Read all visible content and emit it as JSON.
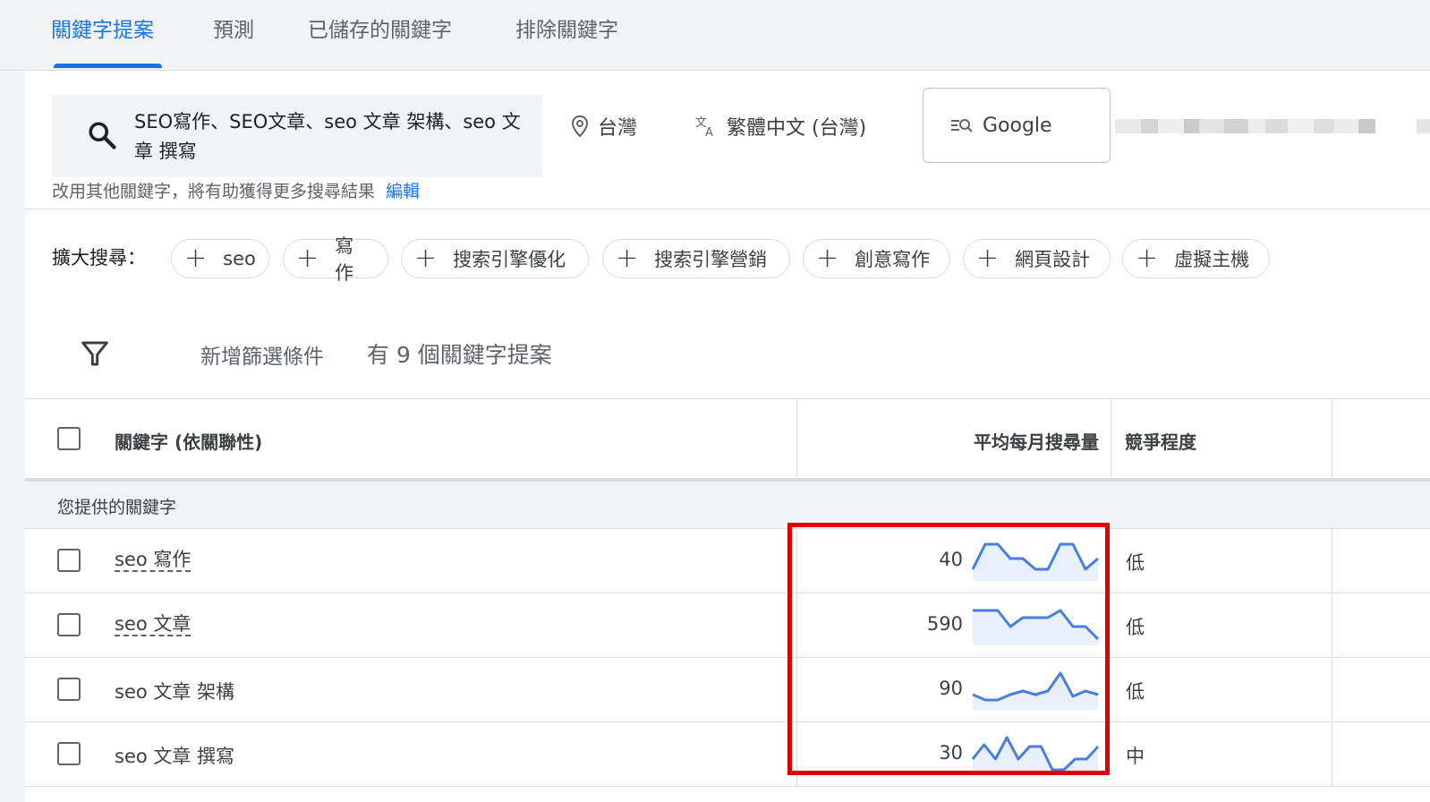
{
  "tabs": [
    {
      "label": "關鍵字提案",
      "active": true
    },
    {
      "label": "預測",
      "active": false
    },
    {
      "label": "已儲存的關鍵字",
      "active": false
    },
    {
      "label": "排除關鍵字",
      "active": false
    }
  ],
  "search": {
    "query": "SEO寫作、SEO文章、seo 文章 架構、seo 文章 撰寫",
    "location": "台灣",
    "language": "繁體中文 (台灣)",
    "engine": "Google"
  },
  "hint": {
    "text": "改用其他關鍵字，將有助獲得更多搜尋結果",
    "edit_link": "編輯"
  },
  "expand": {
    "label": "擴大搜尋：",
    "chips": [
      "seo",
      "寫作",
      "搜索引擎優化",
      "搜索引擎營銷",
      "創意寫作",
      "網頁設計",
      "虛擬主機"
    ]
  },
  "filter": {
    "add_label": "新增篩選條件",
    "count_label": "有 9 個關鍵字提案"
  },
  "table": {
    "headers": {
      "keyword": "關鍵字 (依關聯性)",
      "volume": "平均每月搜尋量",
      "competition": "競爭程度"
    },
    "group_label": "您提供的關鍵字",
    "rows": [
      {
        "keyword": "seo 寫作",
        "volume": "40",
        "competition": "低",
        "trend": [
          0.25,
          0.95,
          0.95,
          0.55,
          0.55,
          0.25,
          0.25,
          0.95,
          0.95,
          0.25,
          0.55
        ]
      },
      {
        "keyword": "seo 文章",
        "volume": "590",
        "competition": "低",
        "trend": [
          0.9,
          0.9,
          0.9,
          0.45,
          0.7,
          0.7,
          0.7,
          0.9,
          0.45,
          0.45,
          0.1
        ]
      },
      {
        "keyword": "seo 文章 架構",
        "volume": "90",
        "competition": "低",
        "trend": [
          0.35,
          0.2,
          0.2,
          0.35,
          0.45,
          0.35,
          0.45,
          0.95,
          0.3,
          0.45,
          0.35
        ]
      },
      {
        "keyword": "seo 文章 撰寫",
        "volume": "30",
        "competition": "中",
        "trend": [
          0.35,
          0.75,
          0.35,
          0.95,
          0.35,
          0.7,
          0.7,
          0.05,
          0.05,
          0.35,
          0.35,
          0.7
        ]
      }
    ]
  },
  "colors": {
    "accent": "#1a73e8",
    "spark_line": "#4a7ede",
    "spark_fill": "#e8f0fe",
    "highlight": "#e00000"
  }
}
